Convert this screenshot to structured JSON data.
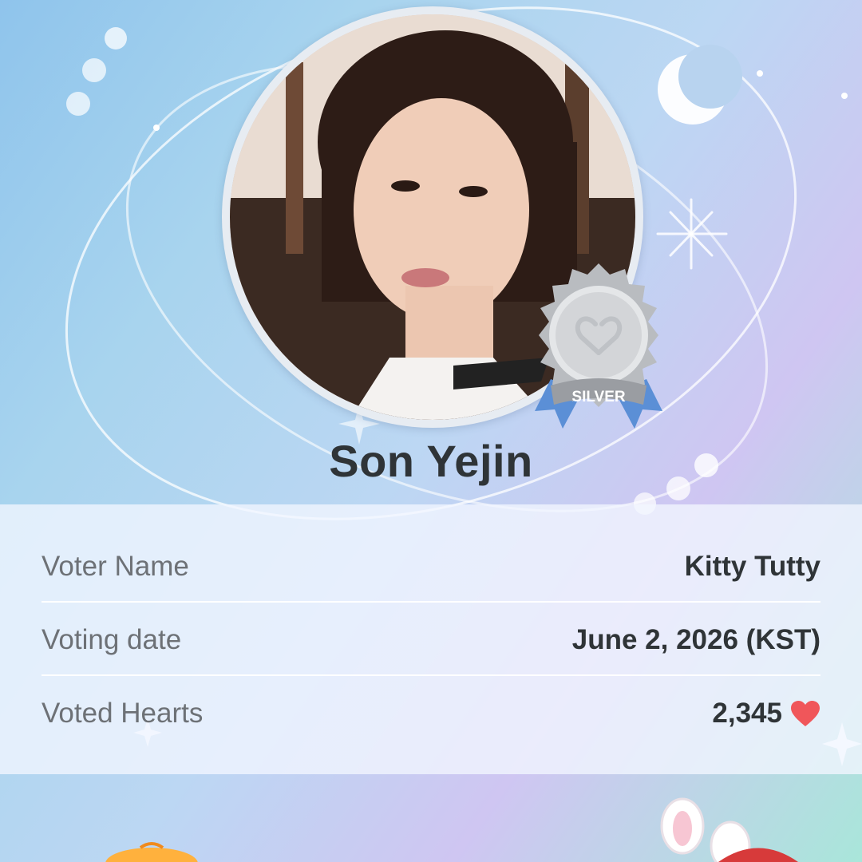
{
  "profile": {
    "name": "Son Yejin",
    "badge": {
      "tier_text": "SILVER",
      "icon": "heart-logo-icon"
    }
  },
  "details": {
    "voter_label": "Voter Name",
    "voter_value": "Kitty Tutty",
    "date_label": "Voting date",
    "date_value": "June 2, 2026 (KST)",
    "hearts_label": "Voted Hearts",
    "hearts_value": "2,345",
    "hearts_icon": "heart-icon"
  },
  "colors": {
    "heart": "#f0565a",
    "ribbon": "#5b8fd6",
    "silver": "#c8cacd",
    "text_dark": "#2f3437",
    "text_muted": "#6d7176"
  }
}
